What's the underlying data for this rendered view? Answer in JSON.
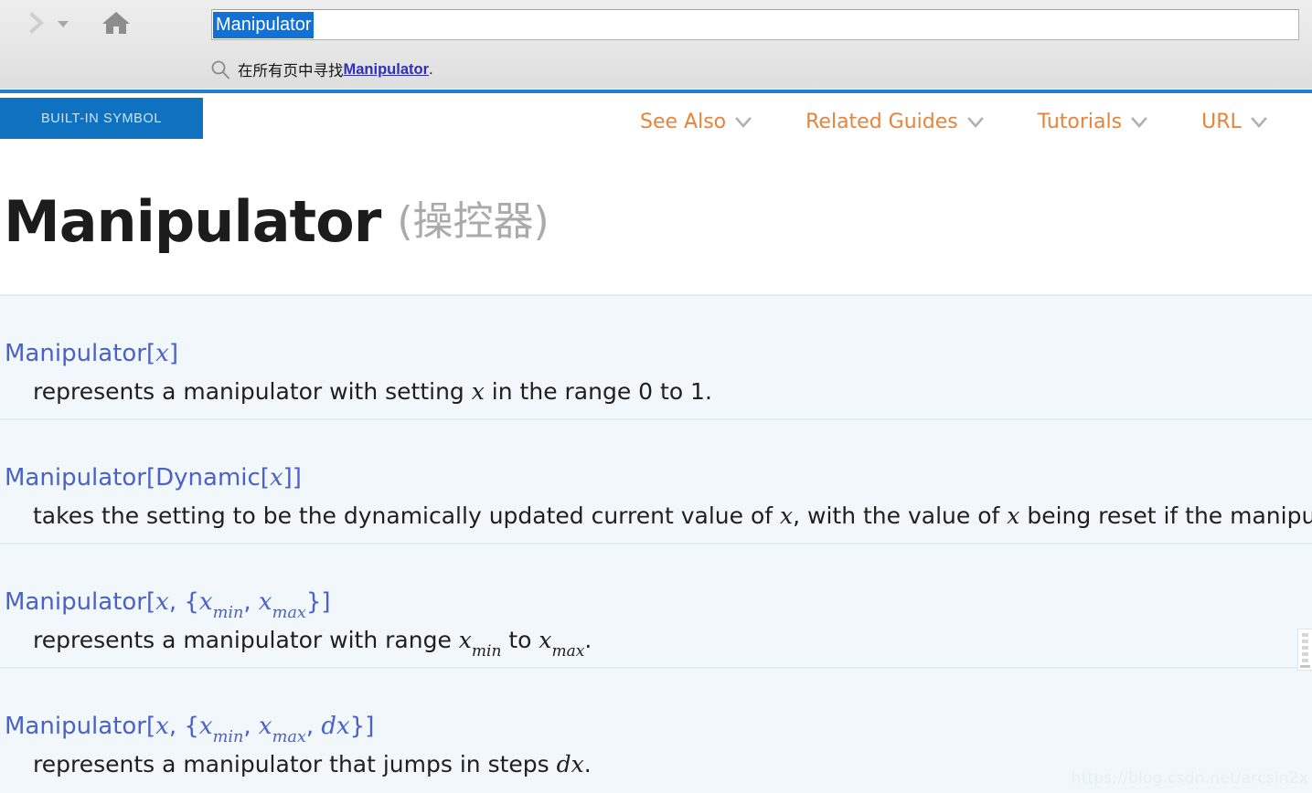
{
  "toolbar": {
    "forward_icon": "chevron-right-icon",
    "dropdown_icon": "caret-down-icon",
    "home_icon": "home-icon",
    "search": {
      "value": "Manipulator",
      "placeholder": ""
    },
    "suggestion": {
      "icon": "search-icon",
      "prefix": "在所有页中寻找",
      "link": "Manipulator",
      "suffix": "."
    }
  },
  "navbar": {
    "badge": "BUILT-IN SYMBOL",
    "links": [
      {
        "label": "See Also",
        "icon": "chevron-down-icon"
      },
      {
        "label": "Related Guides",
        "icon": "chevron-down-icon"
      },
      {
        "label": "Tutorials",
        "icon": "chevron-down-icon"
      },
      {
        "label": "URL",
        "icon": "chevron-down-icon"
      }
    ]
  },
  "page": {
    "title": "Manipulator",
    "title_translation": "(操控器)"
  },
  "usages": [
    {
      "sig_prefix": "Manipulator[",
      "sig_var": "x",
      "sig_suffix": "]",
      "desc_1": "represents a manipulator with setting ",
      "desc_var": "x",
      "desc_2": " in the range 0 to 1."
    },
    {
      "sig_prefix": "Manipulator[Dynamic[",
      "sig_var": "x",
      "sig_suffix": "]]",
      "desc_1": "takes the setting to be the dynamically updated current value of ",
      "desc_var": "x",
      "desc_2": ", with the value of ",
      "desc_var2": "x",
      "desc_3": " being reset if the manipulator is move"
    },
    {
      "sig_prefix": "Manipulator[",
      "sig_var": "x",
      "sig_mid": ", {",
      "sig_sub_base": "x",
      "sig_sub_min": "min",
      "sig_sep": ", ",
      "sig_sub_base2": "x",
      "sig_sub_max": "max",
      "sig_suffix": "}]",
      "desc_1": "represents a manipulator with range ",
      "desc_sub_base": "x",
      "desc_sub_min": "min",
      "desc_2": " to ",
      "desc_sub_base2": "x",
      "desc_sub_max": "max",
      "desc_3": "."
    },
    {
      "sig_prefix": "Manipulator[",
      "sig_var": "x",
      "sig_mid": ", {",
      "sig_sub_base": "x",
      "sig_sub_min": "min",
      "sig_sep": ", ",
      "sig_sub_base2": "x",
      "sig_sub_max": "max",
      "sig_sep2": ", ",
      "sig_dx": "dx",
      "sig_suffix": "}]",
      "desc_1": "represents a manipulator that jumps in steps ",
      "desc_dx": "dx",
      "desc_2": "."
    }
  ],
  "watermark": "https://blog.csdn.net/arcsin2x",
  "colors": {
    "accent_blue": "#0f72c0",
    "link_orange": "#e8833a",
    "signature_blue": "#4a62c8",
    "selection_blue": "#1271d4",
    "panel_bg": "#f1f7fb",
    "separator": "#e2ecf3"
  }
}
